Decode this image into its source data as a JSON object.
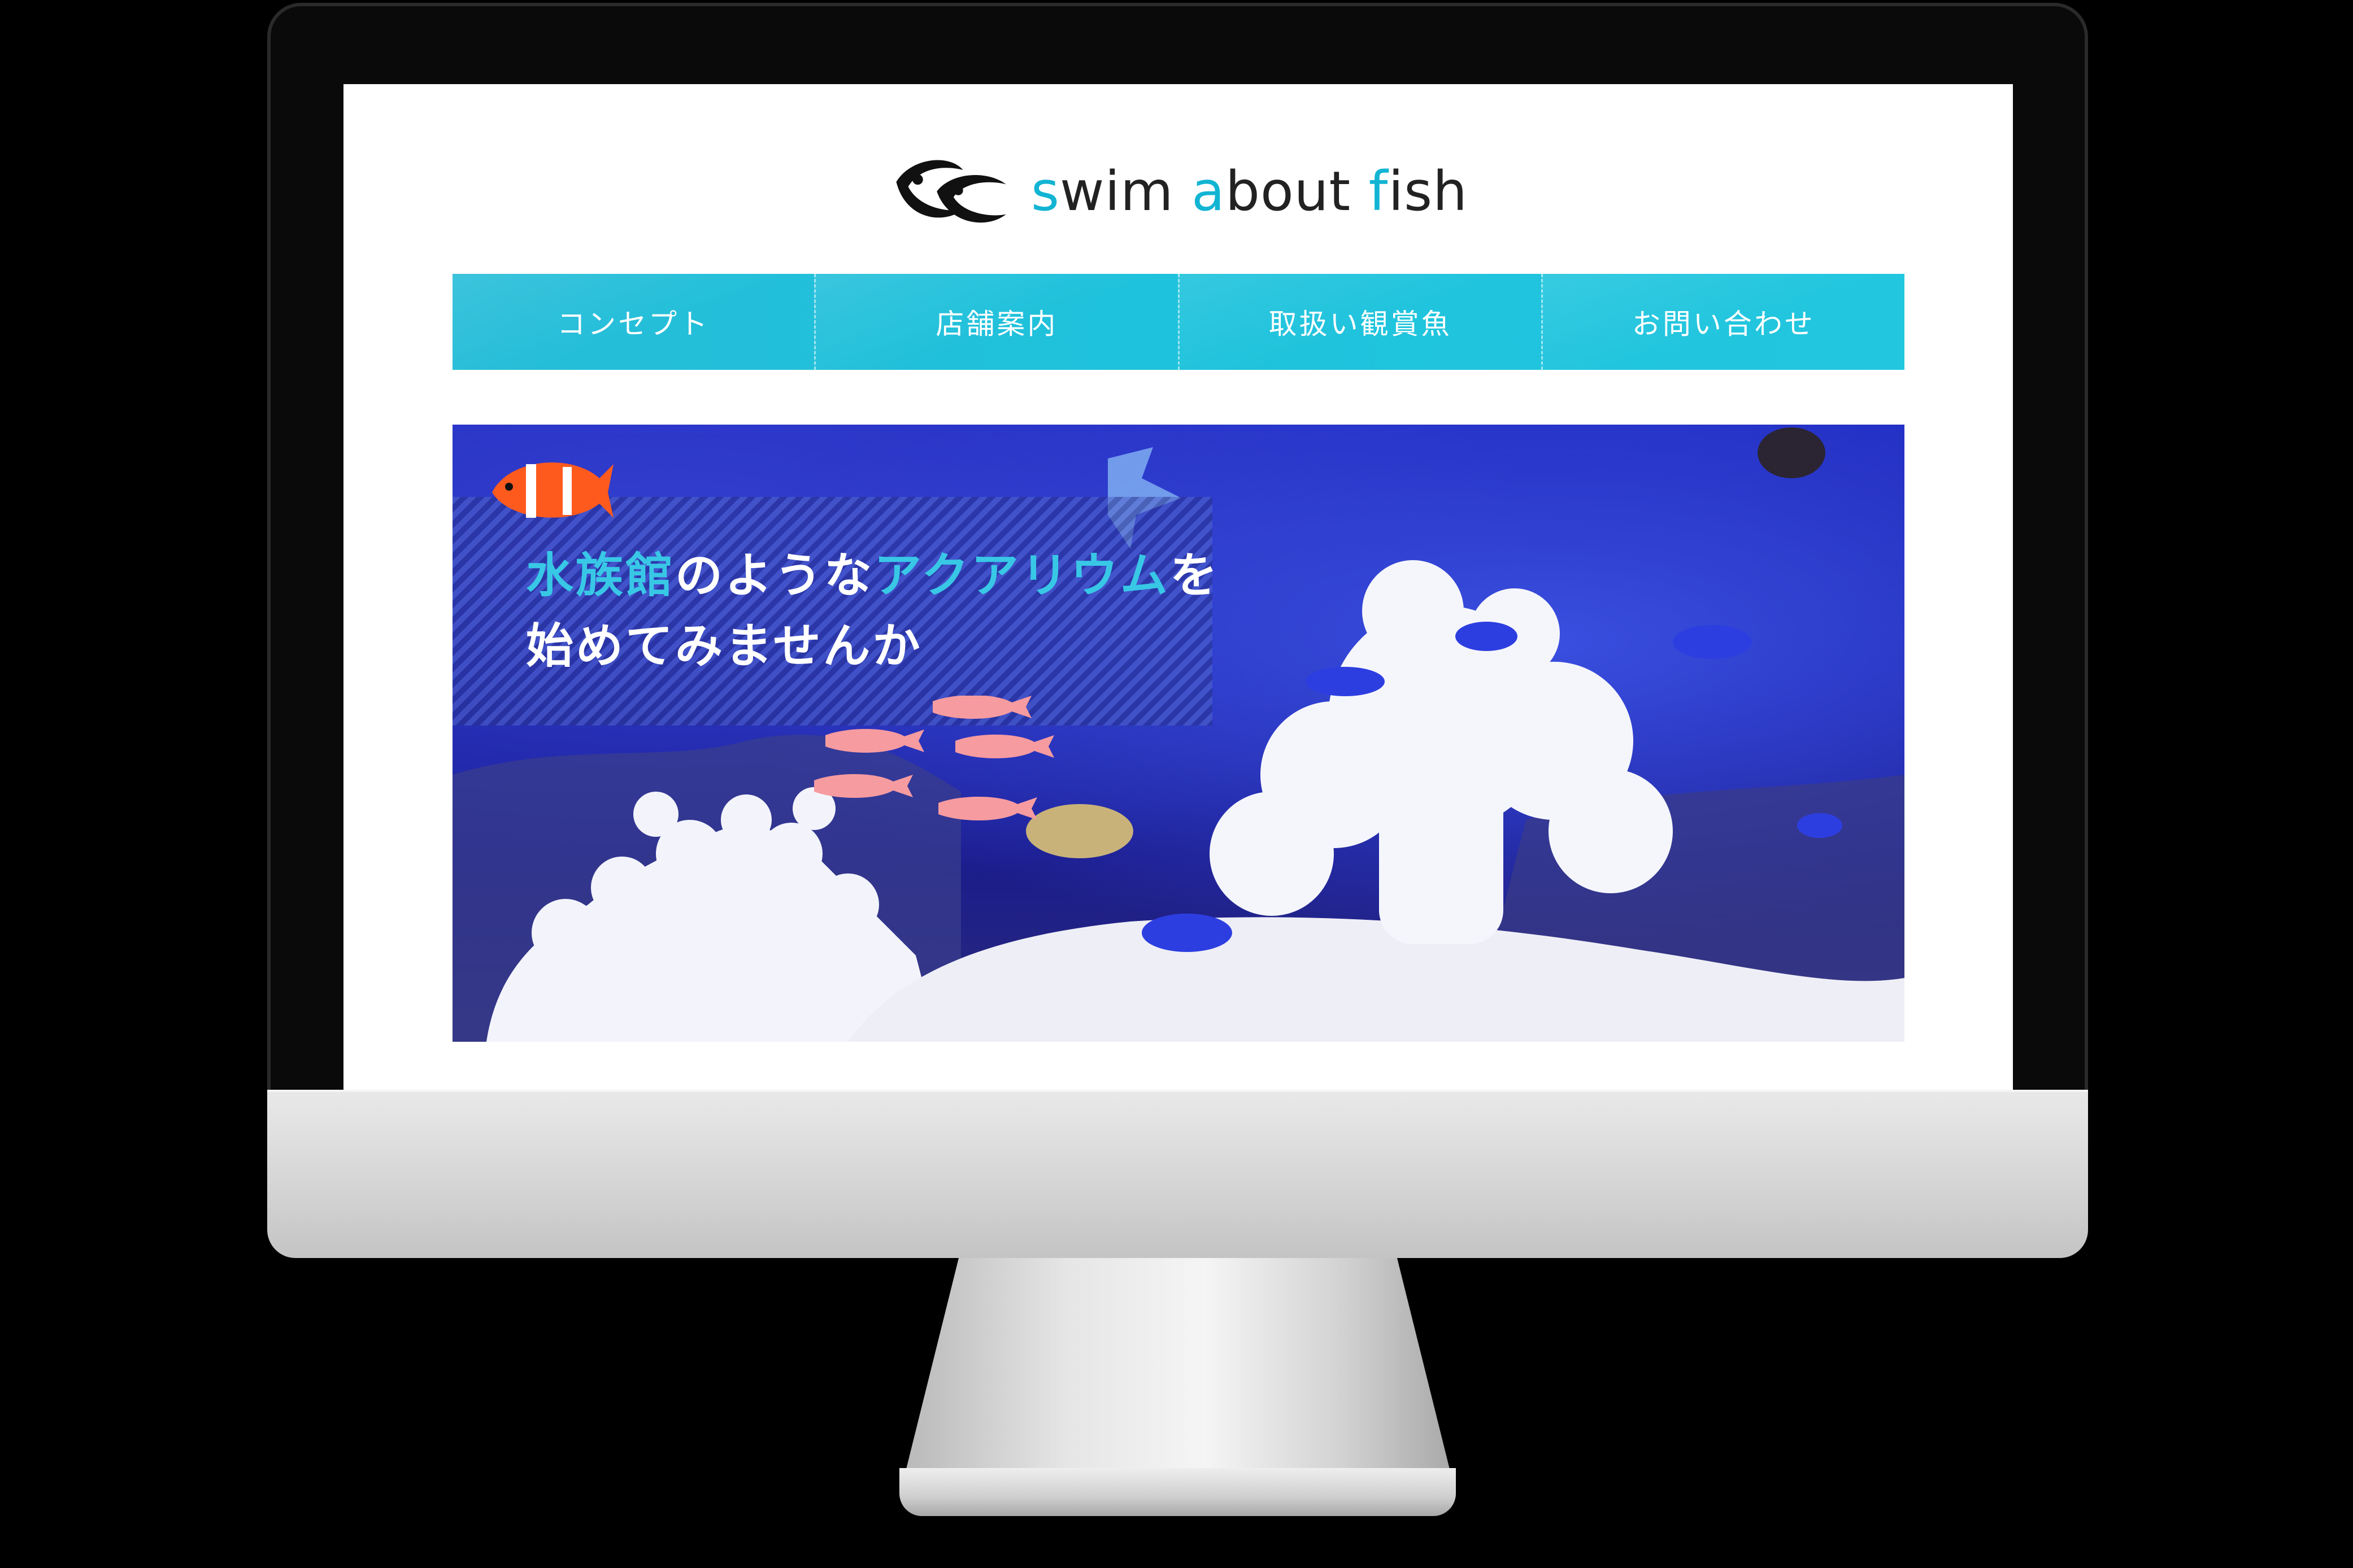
{
  "site": {
    "logo": {
      "part1_accent": "s",
      "part1": "wim ",
      "part2_accent": "a",
      "part2": "bout ",
      "part3_accent": "f",
      "part3": "ish"
    },
    "nav": {
      "items": [
        "コンセプト",
        "店舗案内",
        "取扱い観賞魚",
        "お問い合わせ"
      ]
    },
    "hero": {
      "line1": {
        "seg1": "水族館",
        "seg2": "のような",
        "seg3": "アクアリウム",
        "seg4": "を"
      },
      "line2": "始めてみませんか"
    }
  },
  "colors": {
    "accent": "#12b4d3",
    "nav_bg": "#1ec2dc",
    "hero_highlight": "#38c8e6",
    "monitor_silver": "#d9d9d9"
  },
  "icons": [
    "logo-fish-mark-icon",
    "clownfish-icon",
    "pink-fish-icon",
    "monitor-icon"
  ]
}
